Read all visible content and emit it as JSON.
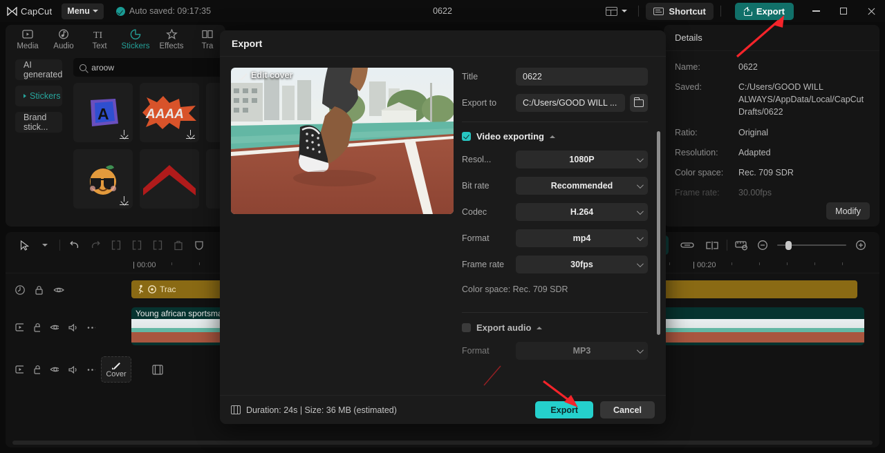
{
  "titlebar": {
    "brand": "CapCut",
    "menu_label": "Menu",
    "autosave_text": "Auto saved: 09:17:35",
    "project_title": "0622",
    "shortcut_label": "Shortcut",
    "export_label": "Export",
    "icons": {
      "logo": "capcut-logo-icon",
      "autosave_check": "check-circle-icon",
      "ratio": "layout-ratio-icon",
      "shortcut": "keyboard-icon",
      "export": "upload-icon",
      "minimize": "minimize-icon",
      "maximize": "maximize-icon",
      "close": "close-icon"
    }
  },
  "left_panel": {
    "tabs": [
      {
        "label": "Media",
        "icon": "media-icon",
        "active": false
      },
      {
        "label": "Audio",
        "icon": "audio-note-icon",
        "active": false
      },
      {
        "label": "Text",
        "icon": "text-icon",
        "active": false
      },
      {
        "label": "Stickers",
        "icon": "sticker-icon",
        "active": true
      },
      {
        "label": "Effects",
        "icon": "sparkle-icon",
        "active": false
      },
      {
        "label": "Tra",
        "icon": "transition-icon",
        "active": false
      }
    ],
    "subnav": [
      {
        "label": "AI generated",
        "active": false
      },
      {
        "label": "Stickers",
        "active": true
      },
      {
        "label": "Brand stick...",
        "active": false
      }
    ],
    "search": {
      "value": "aroow",
      "placeholder": "Search stickers",
      "icon": "search-icon"
    },
    "stickers": [
      {
        "name": "letter-a-sticker",
        "downloadable": true
      },
      {
        "name": "aaaa-burst-sticker",
        "downloadable": true
      },
      {
        "name": "partial-sticker-3",
        "downloadable": false
      },
      {
        "name": "orange-sunglasses-sticker",
        "downloadable": true
      },
      {
        "name": "red-chevron-arrow-sticker",
        "downloadable": false
      },
      {
        "name": "partial-sticker-6",
        "downloadable": false
      }
    ]
  },
  "details_panel": {
    "header": "Details",
    "rows": [
      {
        "key": "Name:",
        "value": "0622"
      },
      {
        "key": "Saved:",
        "value": "C:/Users/GOOD WILL ALWAYS/AppData/Local/CapCut Drafts/0622"
      },
      {
        "key": "Ratio:",
        "value": "Original"
      },
      {
        "key": "Resolution:",
        "value": "Adapted"
      },
      {
        "key": "Color space:",
        "value": "Rec. 709 SDR"
      },
      {
        "key": "Frame rate:",
        "value": "30.00fps"
      }
    ],
    "modify_label": "Modify"
  },
  "timeline": {
    "tools": [
      {
        "name": "select-tool-icon"
      },
      {
        "name": "tool-dropdown-chevron-icon"
      },
      {
        "name": "undo-icon"
      },
      {
        "name": "redo-icon"
      },
      {
        "name": "split-icon"
      },
      {
        "name": "trim-left-icon"
      },
      {
        "name": "trim-right-icon"
      },
      {
        "name": "delete-icon"
      },
      {
        "name": "freeze-shield-icon"
      }
    ],
    "right_tools": [
      {
        "name": "auto-adjust-icon"
      },
      {
        "name": "link-icon"
      },
      {
        "name": "mirror-split-icon"
      },
      {
        "name": "snap-ruler-icon"
      },
      {
        "name": "zoom-out-icon"
      },
      {
        "name": "zoom-slider"
      },
      {
        "name": "zoom-in-icon"
      }
    ],
    "ruler_labels": [
      "00:00",
      "00:20"
    ],
    "tracks": [
      {
        "type": "text",
        "head_icons": [
          "clock-icon",
          "lock-icon",
          "eye-icon"
        ],
        "clip_label": "Trac",
        "clip_icon": "tracking-target-icon"
      },
      {
        "type": "video",
        "head_icons": [
          "video-icon",
          "lock-icon",
          "eye-icon",
          "volume-icon",
          "more-icon"
        ],
        "clip_label": "Young african sportsma"
      },
      {
        "type": "cover",
        "head_icons": [
          "video-icon",
          "lock-icon",
          "eye-icon",
          "volume-icon",
          "more-icon"
        ],
        "cover_label": "Cover",
        "cover_icon": "edit-pencil-icon",
        "strip_icon": "film-icon"
      }
    ]
  },
  "export_dialog": {
    "title": "Export",
    "cover": {
      "edit_label": "Edit cover",
      "icon": "edit-pencil-icon",
      "image": "runner-on-track-thumbnail"
    },
    "fields": {
      "title_label": "Title",
      "title_value": "0622",
      "export_to_label": "Export to",
      "export_to_value": "C:/Users/GOOD WILL ...",
      "folder_icon": "folder-icon"
    },
    "video_section": {
      "label": "Video exporting",
      "checked": true,
      "collapse_icon": "chevron-up-icon",
      "settings": [
        {
          "label": "Resol...",
          "value": "1080P",
          "enabled": true
        },
        {
          "label": "Bit rate",
          "value": "Recommended",
          "enabled": true
        },
        {
          "label": "Codec",
          "value": "H.264",
          "enabled": true
        },
        {
          "label": "Format",
          "value": "mp4",
          "enabled": true
        },
        {
          "label": "Frame rate",
          "value": "30fps",
          "enabled": true
        }
      ],
      "color_space_text": "Color space: Rec. 709 SDR"
    },
    "audio_section": {
      "label": "Export audio",
      "checked": false,
      "collapse_icon": "chevron-up-icon",
      "settings": [
        {
          "label": "Format",
          "value": "MP3",
          "enabled": false
        }
      ]
    },
    "footer": {
      "duration_text": "Duration: 24s | Size: 36 MB (estimated)",
      "duration_icon": "film-icon",
      "export_label": "Export",
      "cancel_label": "Cancel"
    }
  },
  "annotations": {
    "arrow_top": "red-arrow-pointing-to-top-export-button",
    "arrow_bottom": "red-arrow-pointing-to-dialog-export-button"
  },
  "colors": {
    "accent_teal": "#25d0cc",
    "export_top_green": "#117069",
    "active_tab": "#24a098",
    "arrow_red": "#ff2d2d",
    "text_clip": "#8a6a14",
    "video_clip": "#06332f"
  }
}
